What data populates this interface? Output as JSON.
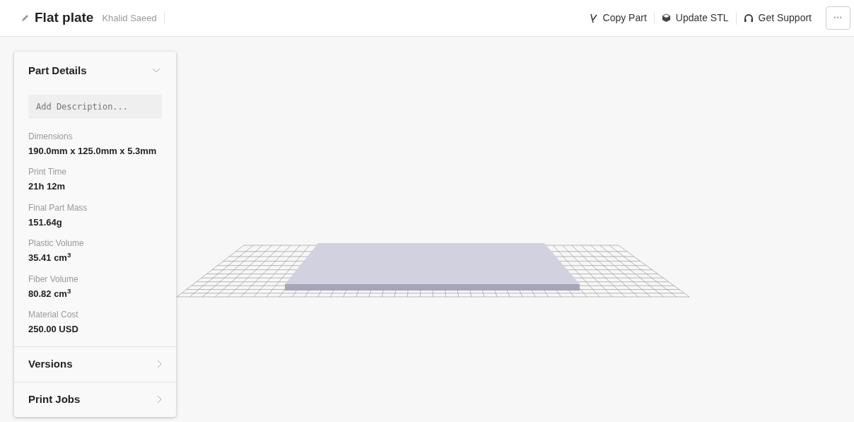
{
  "header": {
    "title": "Flat plate",
    "owner": "Khalid Saeed",
    "actions": [
      {
        "kind": "copy",
        "label": "Copy Part"
      },
      {
        "kind": "update",
        "label": "Update STL"
      },
      {
        "kind": "support",
        "label": "Get Support"
      }
    ],
    "more": "•••"
  },
  "panel": {
    "title": "Part Details",
    "expanded": true,
    "description": {
      "placeholder": "Add Description..."
    },
    "stats": [
      {
        "label": "Dimensions",
        "value": "190.0mm x 125.0mm x 5.3mm"
      },
      {
        "label": "Print Time",
        "value": "21h 12m"
      },
      {
        "label": "Final Part Mass",
        "value": "151.64g"
      },
      {
        "label": "Plastic Volume",
        "value": "35.41 cm$^{3}$"
      },
      {
        "label": "Fiber Volume",
        "value": "80.82 cm$^{3}$"
      },
      {
        "label": "Material Cost",
        "value": "250.00 USD"
      }
    ],
    "sections": [
      {
        "label": "Versions",
        "expanded": false
      },
      {
        "label": "Print Jobs",
        "expanded": false
      }
    ]
  }
}
